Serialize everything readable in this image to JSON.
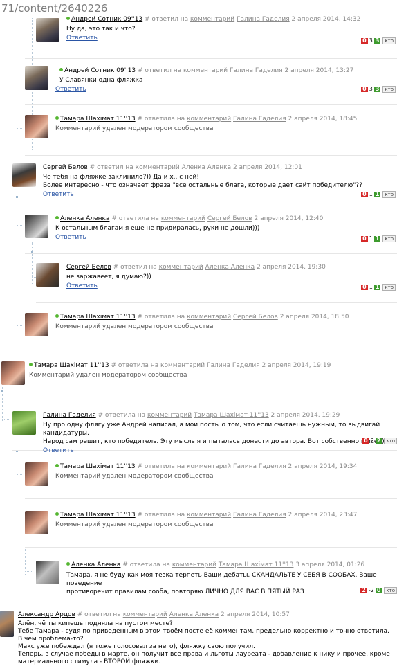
{
  "url": "71/content/2640226",
  "reply_label": "Ответить",
  "kto_label": "кто",
  "comments": [
    {
      "author": "Андрей Сотник 09''13",
      "online": true,
      "meta_pre": "# ответил на",
      "meta_link": "комментарий",
      "target": "Галина Гаделия",
      "date": "2 апреля 2014, 14:32",
      "text": "Ну да, это так и что?",
      "minus": "0",
      "score": "3",
      "plus": "3"
    },
    {
      "author": "Андрей Сотник 09''13",
      "online": true,
      "meta_pre": "# ответил на",
      "meta_link": "комментарий",
      "target": "Галина Гаделия",
      "date": "2 апреля 2014, 13:27",
      "text": "У Славянки одна фляжка",
      "minus": "0",
      "score": "3",
      "plus": "3"
    },
    {
      "author": "Тамара Шахімат 11''13",
      "online": true,
      "meta_pre": "# ответила на",
      "meta_link": "комментарий",
      "target": "Галина Гаделия",
      "date": "2 апреля 2014, 18:45",
      "text": "Комментарий удален модератором сообщества"
    },
    {
      "author": "Сергей Белов",
      "online": false,
      "meta_pre": "# ответил на",
      "meta_link": "комментарий",
      "target": "Аленка Аленка",
      "date": "2 апреля 2014, 12:01",
      "text": "Че тебя на фляжке заклинило?)) Да и х.. с ней!\nБолее интересно - что означает фраза \"все остальные блага, которые дает сайт победителю\"??",
      "minus": "0",
      "score": "1",
      "plus": "1"
    },
    {
      "author": "Аленка Аленка",
      "online": true,
      "meta_pre": "# ответила на",
      "meta_link": "комментарий",
      "target": "Сергей Белов",
      "date": "2 апреля 2014, 12:40",
      "text": "К остальным благам я еще не придиралась, руки не дошли)))",
      "minus": "0",
      "score": "1",
      "plus": "1"
    },
    {
      "author": "Сергей Белов",
      "online": false,
      "meta_pre": "# ответил на",
      "meta_link": "комментарий",
      "target": "Аленка Аленка",
      "date": "2 апреля 2014, 19:30",
      "text": "не заржавеет, я думаю?))",
      "minus": "0",
      "score": "1",
      "plus": "1"
    },
    {
      "author": "Тамара Шахімат 11''13",
      "online": true,
      "meta_pre": "# ответила на",
      "meta_link": "комментарий",
      "target": "Сергей Белов",
      "date": "2 апреля 2014, 18:50",
      "text": "Комментарий удален модератором сообщества"
    },
    {
      "author": "Тамара Шахімат 11''13",
      "online": true,
      "meta_pre": "# ответила на",
      "meta_link": "комментарий",
      "target": "Галина Гаделия",
      "date": "2 апреля 2014, 19:19",
      "text": "Комментарий удален модератором сообщества"
    },
    {
      "author": "Галина Гаделия",
      "online": false,
      "meta_pre": "# ответила на",
      "meta_link": "комментарий",
      "target": "Тамара Шахімат 11''13",
      "date": "2 апреля 2014, 19:29",
      "text": "Ну про одну флягу уже Андрей написал, а мои посты о том, что если считаешь нужным, то выдвигай кандидатуры.\nНарод сам решит, кто победитель. Эту мысль я и пыталась донести до автора. Вот собственно и все. ))",
      "minus": "0",
      "score": "2",
      "plus": "2"
    },
    {
      "author": "Тамара Шахімат 11''13",
      "online": true,
      "meta_pre": "# ответила на",
      "meta_link": "комментарий",
      "target": "Галина Гаделия",
      "date": "2 апреля 2014, 19:34",
      "text": "Комментарий удален модератором сообщества"
    },
    {
      "author": "Тамара Шахімат 11''13",
      "online": true,
      "meta_pre": "# ответила на",
      "meta_link": "комментарий",
      "target": "Галина Гаделия",
      "date": "2 апреля 2014, 23:47",
      "text": "Комментарий удален модератором сообщества"
    },
    {
      "author": "Аленка Аленка",
      "online": true,
      "meta_pre": "# ответила на",
      "meta_link": "комментарий",
      "target": "Тамара Шахімат 11''13",
      "date": "3 апреля 2014, 01:26",
      "text": "Тамара, я не буду как моя тезка терпеть Ваши дебаты, СКАНДАЛЬТЕ У СЕБЯ В СООБАХ, Ваше поведение\nпротиворечит правилам сооба, повторяю ЛИЧНО ДЛЯ ВАС В ПЯТЫЙ РАЗ",
      "minus": "2",
      "score": "-2",
      "plus": "0"
    },
    {
      "author": "Александр Арцов",
      "online": false,
      "meta_pre": "# ответил на",
      "meta_link": "комментарий",
      "target": "Аленка Аленка",
      "date": "2 апреля 2014, 10:57",
      "text": "Алён, чё ты кипешь подняла на пустом месте?\nТебе Тамара - судя по приведенным в этом твоём посте её комментам, предельно корректно и точно ответила.\nВ чём проблема-то?\nМакс уже побеждал (я тоже голосовал за него), фляжку свою получил.\nТеперь, в случае победы в марте, он получит все права и льготы лауреата - добавление к нику и прочее, кроме\nматериального стимула - ВТОРОЙ фляжки."
    }
  ]
}
